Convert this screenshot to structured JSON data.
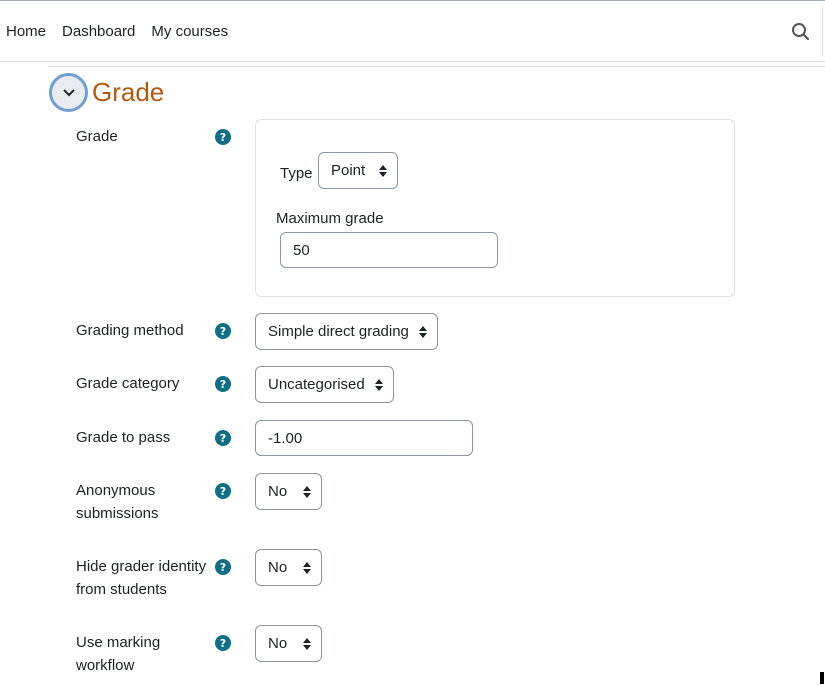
{
  "nav": {
    "items": [
      "Home",
      "Dashboard",
      "My courses"
    ]
  },
  "icons": {
    "search": "search-icon",
    "collapse": "chevron-down-icon",
    "help": "question-icon",
    "select_arrows": "sort-arrows-icon"
  },
  "section": {
    "title": "Grade"
  },
  "grade": {
    "label": "Grade",
    "type_label": "Type",
    "type_value": "Point",
    "max_label": "Maximum grade",
    "max_value": "50"
  },
  "grading_method": {
    "label": "Grading method",
    "value": "Simple direct grading"
  },
  "grade_category": {
    "label": "Grade category",
    "value": "Uncategorised"
  },
  "grade_to_pass": {
    "label": "Grade to pass",
    "value": "-1.00"
  },
  "anonymous": {
    "label": "Anonymous submissions",
    "value": "No"
  },
  "hide_grader": {
    "label": "Hide grader identity from students",
    "value": "No"
  },
  "marking_workflow": {
    "label": "Use marking workflow",
    "value": "No"
  },
  "help_glyph": "?",
  "colors": {
    "section_title": "#b35a10",
    "help_icon": "#0f6e84",
    "focus_ring": "#6f9ed3"
  }
}
